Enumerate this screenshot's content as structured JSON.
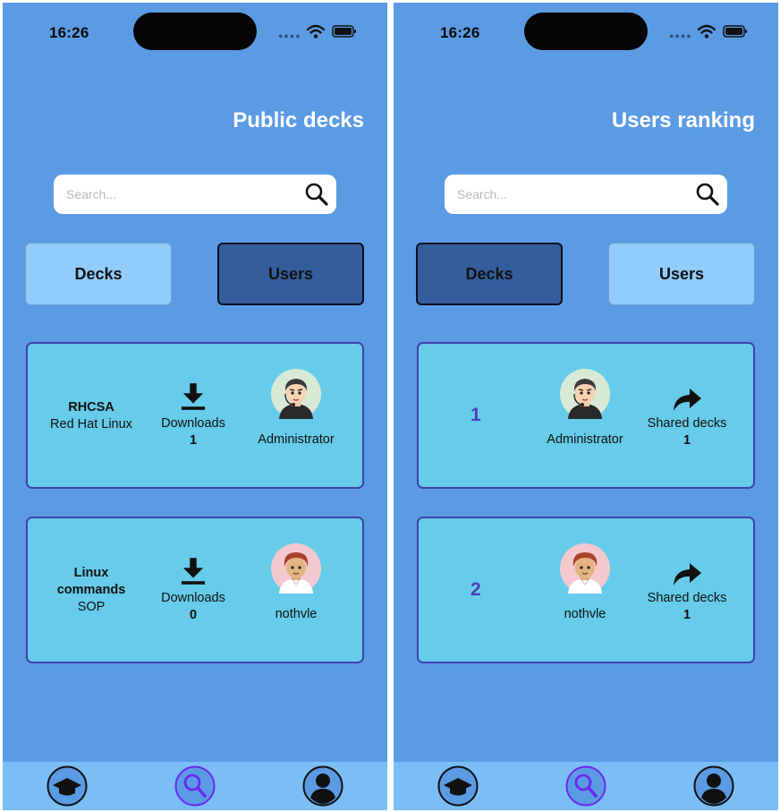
{
  "status": {
    "time": "16:26"
  },
  "colors": {
    "background": "#5b9be4",
    "card": "#66ccea",
    "card_border": "#3e42ad",
    "tab_active": "#335e9b",
    "tab_inactive": "#92ccfa",
    "rank_number": "#4c3fb5",
    "nav_active": "#6a2af0"
  },
  "search": {
    "placeholder": "Search..."
  },
  "tabs": {
    "decks": "Decks",
    "users": "Users"
  },
  "left_screen": {
    "title": "Public decks",
    "active_tab": "users",
    "decks": [
      {
        "name": "RHCSA",
        "subtitle": "Red Hat Linux",
        "downloads_label": "Downloads",
        "downloads": "1",
        "owner": "Administrator"
      },
      {
        "name_lines": [
          "Linux",
          "commands"
        ],
        "subtitle": "SOP",
        "downloads_label": "Downloads",
        "downloads": "0",
        "owner": "nothvle"
      }
    ]
  },
  "right_screen": {
    "title": "Users ranking",
    "active_tab": "decks",
    "users": [
      {
        "rank": "1",
        "name": "Administrator",
        "shared_label": "Shared decks",
        "shared": "1"
      },
      {
        "rank": "2",
        "name": "nothvle",
        "shared_label": "Shared decks",
        "shared": "1"
      }
    ]
  },
  "bottom_nav": {
    "items": [
      "graduation-cap-icon",
      "search-icon",
      "user-icon"
    ],
    "active": "search-icon"
  }
}
